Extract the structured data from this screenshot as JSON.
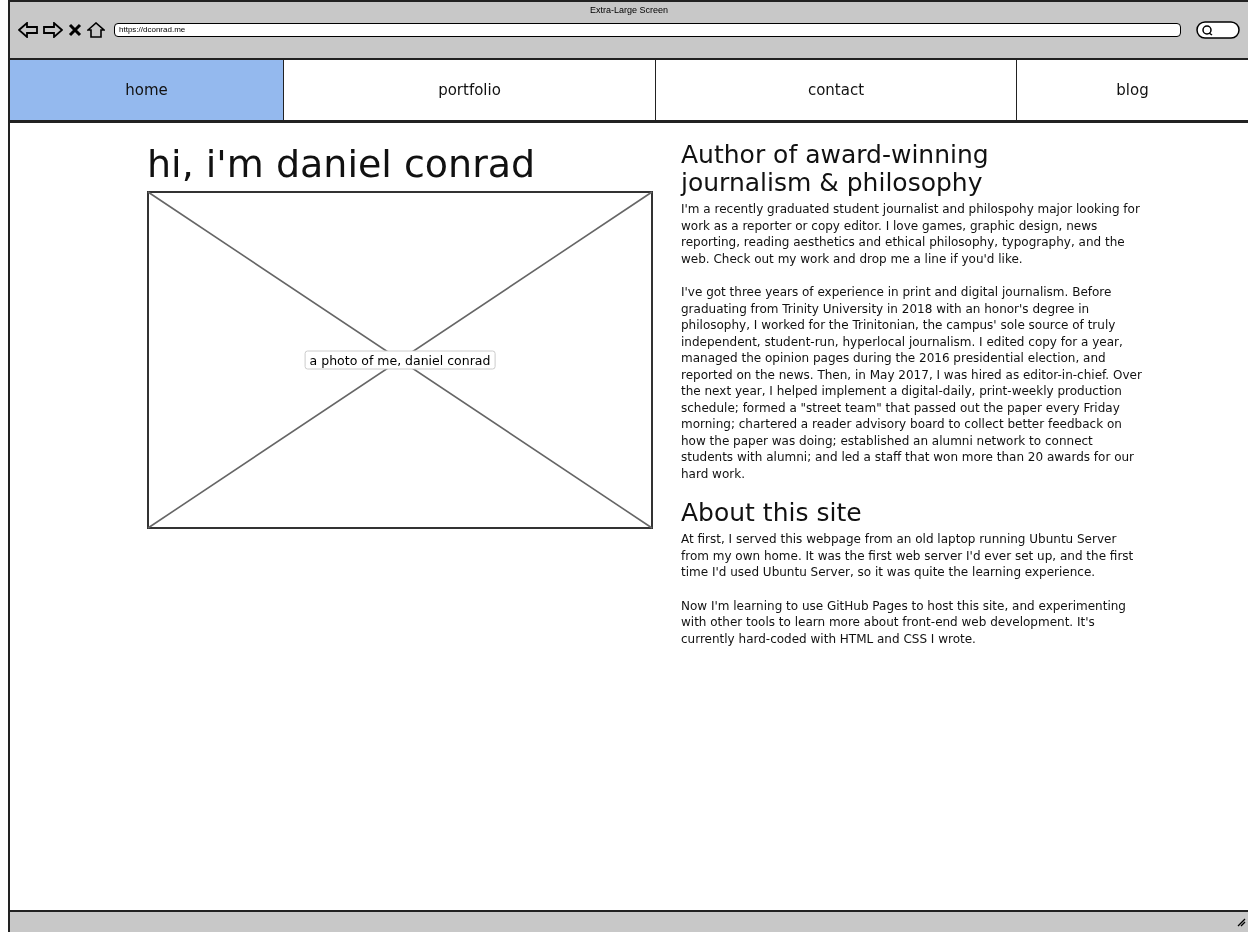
{
  "browser": {
    "title": "Extra-Large Screen",
    "url": "https://dconrad.me"
  },
  "nav": [
    {
      "label": "home",
      "selected": true
    },
    {
      "label": "portfolio",
      "selected": false
    },
    {
      "label": "contact",
      "selected": false
    },
    {
      "label": "blog",
      "selected": false
    }
  ],
  "intro": {
    "heading": "hi, i'm daniel conrad",
    "photo_caption": "a photo of me, daniel conrad"
  },
  "sections": [
    {
      "heading": "Author of award-winning journalism & philosophy",
      "paragraphs": [
        "I'm a recently graduated student journalist and philospohy major looking for work as a reporter or copy editor. I love games, graphic design, news reporting, reading aesthetics and ethical philosophy, typography, and the web. Check out my work and drop me a line if you'd like.",
        "I've got three years of experience in print and digital journalism. Before graduating from Trinity University in 2018 with an honor's degree in philosophy, I worked for the Trinitonian, the campus' sole source of truly independent, student-run, hyperlocal journalism. I edited copy for a year, managed the opinion pages during the 2016 presidential election, and reported on the news. Then, in May 2017, I was hired as editor-in-chief. Over the next year, I helped implement a digital-daily, print-weekly production schedule; formed a \"street team\" that passed out the paper every Friday morning; chartered a reader advisory board to collect better feedback on how the paper was doing; established an alumni network to connect students with alumni; and led a staff that won more than 20 awards for our hard work."
      ]
    },
    {
      "heading": "About this site",
      "paragraphs": [
        "At first, I served this webpage from an old laptop running Ubuntu Server from my own home. It was the first web server I'd ever set up, and the first time I'd used Ubuntu Server, so it was quite the learning experience.",
        "Now I'm learning to use GitHub Pages to host this site, and experimenting with other tools to learn more about front-end web development. It's currently hard-coded with HTML and CSS I wrote."
      ]
    }
  ]
}
